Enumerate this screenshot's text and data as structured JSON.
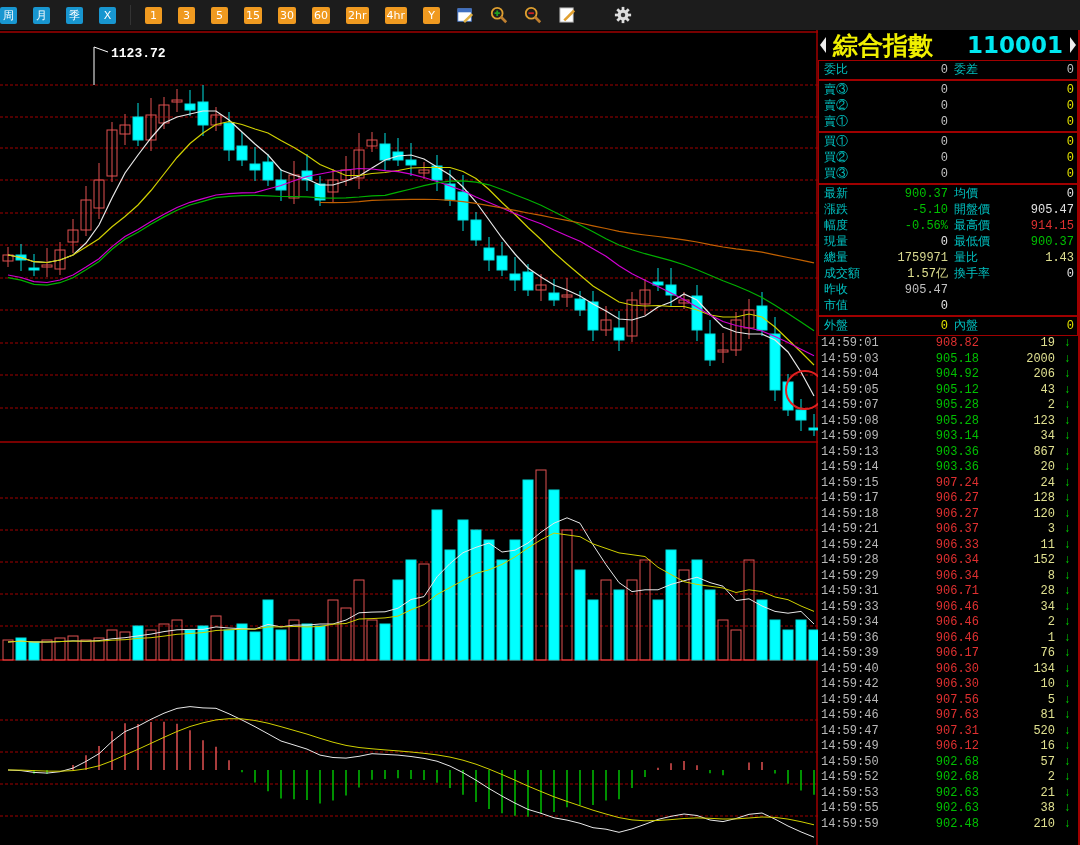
{
  "toolbar": {
    "buttons": [
      {
        "label": "周",
        "kind": "cycle"
      },
      {
        "label": "月",
        "kind": "cycle"
      },
      {
        "label": "季",
        "kind": "cycle"
      },
      {
        "label": "X",
        "kind": "cycle"
      },
      {
        "label": "1",
        "kind": "minute"
      },
      {
        "label": "3",
        "kind": "minute"
      },
      {
        "label": "5",
        "kind": "minute"
      },
      {
        "label": "15",
        "kind": "minute"
      },
      {
        "label": "30",
        "kind": "minute"
      },
      {
        "label": "60",
        "kind": "minute"
      },
      {
        "label": "2hr",
        "kind": "minute"
      },
      {
        "label": "4hr",
        "kind": "minute"
      },
      {
        "label": "Y",
        "kind": "minute"
      }
    ]
  },
  "chart": {
    "high_label": "1123.72"
  },
  "quote": {
    "title": "綜合指數",
    "code": "110001",
    "sections": [
      {
        "rows": [
          {
            "label": "委比",
            "value": {
              "text": "0",
              "color": "#c0c0c0"
            },
            "label2": "委差",
            "value2": {
              "text": "0",
              "color": "#c0c0c0"
            }
          }
        ]
      },
      {
        "rows": [
          {
            "label": "賣③",
            "value": {
              "text": "0",
              "color": "#c0c0c0"
            },
            "value2": {
              "text": "0",
              "color": "#e0e000"
            }
          },
          {
            "label": "賣②",
            "value": {
              "text": "0",
              "color": "#c0c0c0"
            },
            "value2": {
              "text": "0",
              "color": "#e0e000"
            }
          },
          {
            "label": "賣①",
            "value": {
              "text": "0",
              "color": "#c0c0c0"
            },
            "value2": {
              "text": "0",
              "color": "#e0e000"
            }
          }
        ]
      },
      {
        "rows": [
          {
            "label": "買①",
            "value": {
              "text": "0",
              "color": "#c0c0c0"
            },
            "value2": {
              "text": "0",
              "color": "#e0e000"
            }
          },
          {
            "label": "買②",
            "value": {
              "text": "0",
              "color": "#c0c0c0"
            },
            "value2": {
              "text": "0",
              "color": "#e0e000"
            }
          },
          {
            "label": "買③",
            "value": {
              "text": "0",
              "color": "#c0c0c0"
            },
            "value2": {
              "text": "0",
              "color": "#e0e000"
            }
          }
        ]
      },
      {
        "rows": [
          {
            "label": "最新",
            "value": {
              "text": "900.37",
              "color": "#00c000"
            },
            "label2": "均價",
            "value2": {
              "text": "0",
              "color": "#e0e0e0"
            }
          },
          {
            "label": "漲跌",
            "value": {
              "text": "-5.10",
              "color": "#00c000"
            },
            "label2": "開盤價",
            "value2": {
              "text": "905.47",
              "color": "#e0e0e0"
            }
          },
          {
            "label": "幅度",
            "value": {
              "text": "-0.56%",
              "color": "#00c000"
            },
            "label2": "最高價",
            "value2": {
              "text": "914.15",
              "color": "#e03030"
            }
          },
          {
            "label": "現量",
            "value": {
              "text": "0",
              "color": "#e0e0e0"
            },
            "label2": "最低價",
            "value2": {
              "text": "900.37",
              "color": "#00c000"
            }
          },
          {
            "label": "總量",
            "value": {
              "text": "1759971",
              "color": "#d8d890"
            },
            "label2": "量比",
            "value2": {
              "text": "1.43",
              "color": "#e0e090"
            }
          },
          {
            "label": "成交額",
            "value": {
              "text": "1.57亿",
              "color": "#e0e090"
            },
            "label2": "換手率",
            "value2": {
              "text": "0",
              "color": "#e0e0e0"
            }
          },
          {
            "label": "昨收",
            "value": {
              "text": "905.47",
              "color": "#c0c0c0"
            }
          },
          {
            "label": "市值",
            "value": {
              "text": "0",
              "color": "#e0e0e0"
            }
          }
        ]
      },
      {
        "rows": [
          {
            "label": "外盤",
            "value": {
              "text": "0",
              "color": "#e0e000"
            },
            "label2": "內盤",
            "value2": {
              "text": "0",
              "color": "#e0e000"
            }
          }
        ]
      }
    ]
  },
  "ticks": [
    {
      "time": "14:59:01",
      "price": "908.82",
      "color": "#e03030",
      "volume": "19",
      "arrow": "↓"
    },
    {
      "time": "14:59:03",
      "price": "905.18",
      "color": "#00c000",
      "volume": "2000",
      "arrow": "↓"
    },
    {
      "time": "14:59:04",
      "price": "904.92",
      "color": "#00c000",
      "volume": "206",
      "arrow": "↓"
    },
    {
      "time": "14:59:05",
      "price": "905.12",
      "color": "#00c000",
      "volume": "43",
      "arrow": "↓"
    },
    {
      "time": "14:59:07",
      "price": "905.28",
      "color": "#00c000",
      "volume": "2",
      "arrow": "↓"
    },
    {
      "time": "14:59:08",
      "price": "905.28",
      "color": "#00c000",
      "volume": "123",
      "arrow": "↓"
    },
    {
      "time": "14:59:09",
      "price": "903.14",
      "color": "#00c000",
      "volume": "34",
      "arrow": "↓"
    },
    {
      "time": "14:59:13",
      "price": "903.36",
      "color": "#00c000",
      "volume": "867",
      "arrow": "↓"
    },
    {
      "time": "14:59:14",
      "price": "903.36",
      "color": "#00c000",
      "volume": "20",
      "arrow": "↓"
    },
    {
      "time": "14:59:15",
      "price": "907.24",
      "color": "#e03030",
      "volume": "24",
      "arrow": "↓"
    },
    {
      "time": "14:59:17",
      "price": "906.27",
      "color": "#e03030",
      "volume": "128",
      "arrow": "↓"
    },
    {
      "time": "14:59:18",
      "price": "906.27",
      "color": "#e03030",
      "volume": "120",
      "arrow": "↓"
    },
    {
      "time": "14:59:21",
      "price": "906.37",
      "color": "#e03030",
      "volume": "3",
      "arrow": "↓"
    },
    {
      "time": "14:59:24",
      "price": "906.33",
      "color": "#e03030",
      "volume": "11",
      "arrow": "↓"
    },
    {
      "time": "14:59:28",
      "price": "906.34",
      "color": "#e03030",
      "volume": "152",
      "arrow": "↓"
    },
    {
      "time": "14:59:29",
      "price": "906.34",
      "color": "#e03030",
      "volume": "8",
      "arrow": "↓"
    },
    {
      "time": "14:59:31",
      "price": "906.71",
      "color": "#e03030",
      "volume": "28",
      "arrow": "↓"
    },
    {
      "time": "14:59:33",
      "price": "906.46",
      "color": "#e03030",
      "volume": "34",
      "arrow": "↓"
    },
    {
      "time": "14:59:34",
      "price": "906.46",
      "color": "#e03030",
      "volume": "2",
      "arrow": "↓"
    },
    {
      "time": "14:59:36",
      "price": "906.46",
      "color": "#e03030",
      "volume": "1",
      "arrow": "↓"
    },
    {
      "time": "14:59:39",
      "price": "906.17",
      "color": "#e03030",
      "volume": "76",
      "arrow": "↓"
    },
    {
      "time": "14:59:40",
      "price": "906.30",
      "color": "#e03030",
      "volume": "134",
      "arrow": "↓"
    },
    {
      "time": "14:59:42",
      "price": "906.30",
      "color": "#e03030",
      "volume": "10",
      "arrow": "↓"
    },
    {
      "time": "14:59:44",
      "price": "907.56",
      "color": "#e03030",
      "volume": "5",
      "arrow": "↓"
    },
    {
      "time": "14:59:46",
      "price": "907.63",
      "color": "#e03030",
      "volume": "81",
      "arrow": "↓"
    },
    {
      "time": "14:59:47",
      "price": "907.31",
      "color": "#e03030",
      "volume": "520",
      "arrow": "↓"
    },
    {
      "time": "14:59:49",
      "price": "906.12",
      "color": "#e03030",
      "volume": "16",
      "arrow": "↓"
    },
    {
      "time": "14:59:50",
      "price": "902.68",
      "color": "#00c000",
      "volume": "57",
      "arrow": "↓"
    },
    {
      "time": "14:59:52",
      "price": "902.68",
      "color": "#00c000",
      "volume": "2",
      "arrow": "↓"
    },
    {
      "time": "14:59:53",
      "price": "902.63",
      "color": "#00c000",
      "volume": "21",
      "arrow": "↓"
    },
    {
      "time": "14:59:55",
      "price": "902.63",
      "color": "#00c000",
      "volume": "38",
      "arrow": "↓"
    },
    {
      "time": "14:59:59",
      "price": "902.48",
      "color": "#00c000",
      "volume": "210",
      "arrow": "↓"
    }
  ]
}
